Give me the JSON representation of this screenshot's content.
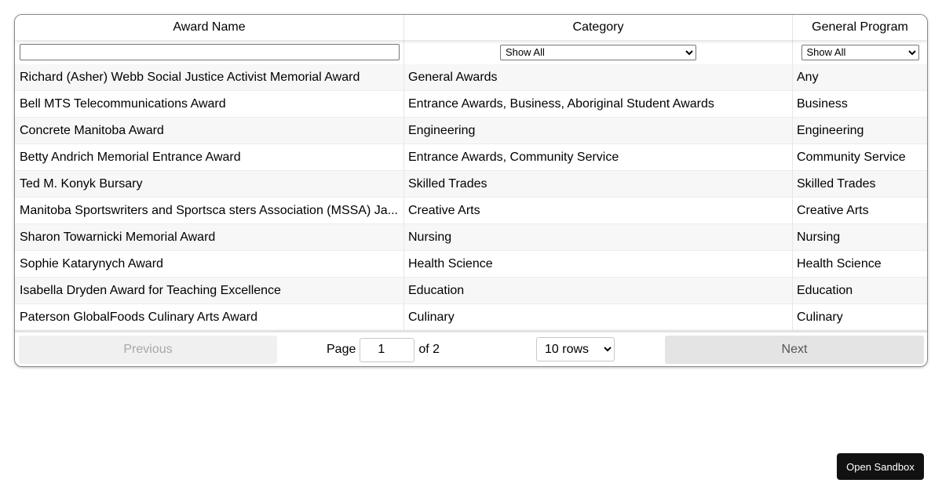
{
  "table": {
    "columns": [
      "Award Name",
      "Category",
      "General Program"
    ],
    "filters": {
      "award_name_value": "",
      "category_selected": "Show All",
      "program_selected": "Show All"
    },
    "rows": [
      [
        "Richard (Asher) Webb Social Justice Activist Memorial Award",
        "General Awards",
        "Any"
      ],
      [
        "Bell MTS Telecommunications Award",
        "Entrance Awards, Business, Aboriginal Student Awards",
        "Business"
      ],
      [
        "Concrete Manitoba Award",
        "Engineering",
        "Engineering"
      ],
      [
        "Betty Andrich Memorial Entrance Award",
        "Entrance Awards, Community Service",
        "Community Service"
      ],
      [
        "Ted M. Konyk Bursary",
        "Skilled Trades",
        "Skilled Trades"
      ],
      [
        "Manitoba Sportswriters and Sportsca sters Association (MSSA) Ja...",
        "Creative Arts",
        "Creative Arts"
      ],
      [
        "Sharon Towarnicki Memorial Award",
        "Nursing",
        "Nursing"
      ],
      [
        "Sophie Katarynych Award",
        "Health Science",
        "Health Science"
      ],
      [
        "Isabella Dryden Award for Teaching Excellence",
        "Education",
        "Education"
      ],
      [
        "Paterson GlobalFoods Culinary Arts Award",
        "Culinary",
        "Culinary"
      ]
    ]
  },
  "pagination": {
    "previous_label": "Previous",
    "next_label": "Next",
    "page_label": "Page",
    "current_page": "1",
    "of_label": "of 2",
    "rows_option": "10 rows"
  },
  "sandbox_button_label": "Open Sandbox"
}
